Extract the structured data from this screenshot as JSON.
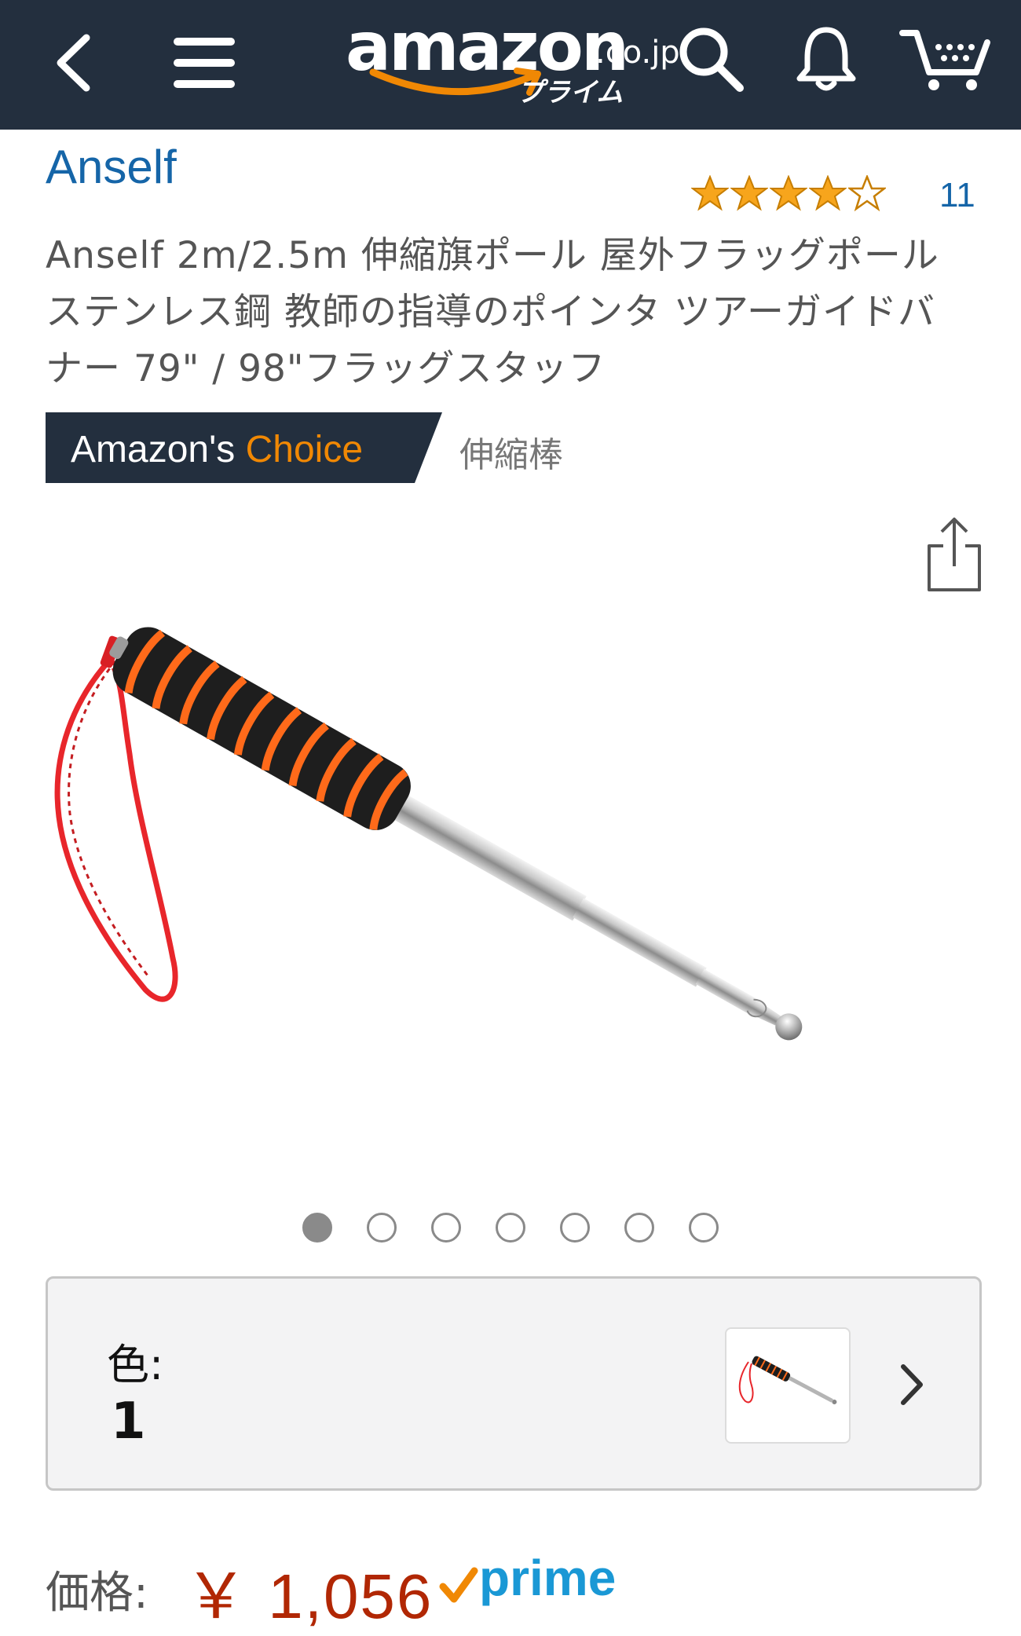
{
  "header": {
    "logo_word": "amazon",
    "logo_suffix": ".co.jp",
    "logo_sub": "プライム",
    "colors": {
      "background": "#232f3e",
      "icon": "#ffffff",
      "smile": "#f08804"
    },
    "icons": [
      "back-icon",
      "menu-icon",
      "search-icon",
      "bell-icon",
      "cart-icon"
    ]
  },
  "product": {
    "brand": "Anself",
    "rating": 4.5,
    "rating_max": 5,
    "review_count": "11",
    "title": "Anself 2m/2.5m 伸縮旗ポール 屋外フラッグポール ステンレス鋼 教師の指導のポインタ ツアーガイドバナー 79\" / 98\"フラッグスタッフ",
    "choice_badge": {
      "prefix": "Amazon's",
      "highlight": "Choice"
    },
    "choice_category": "伸縮棒",
    "image_count": 7,
    "image_active_index": 0
  },
  "variation": {
    "label": "色:",
    "value": "1"
  },
  "price": {
    "label": "価格:",
    "value": "￥ 1,056",
    "prime_label": "prime",
    "colors": {
      "price": "#b12704",
      "prime": "#1a98d5",
      "check": "#f08804"
    }
  },
  "colors": {
    "link": "#1565a8",
    "badge": "#232f3e",
    "star": "#f7a51c"
  }
}
